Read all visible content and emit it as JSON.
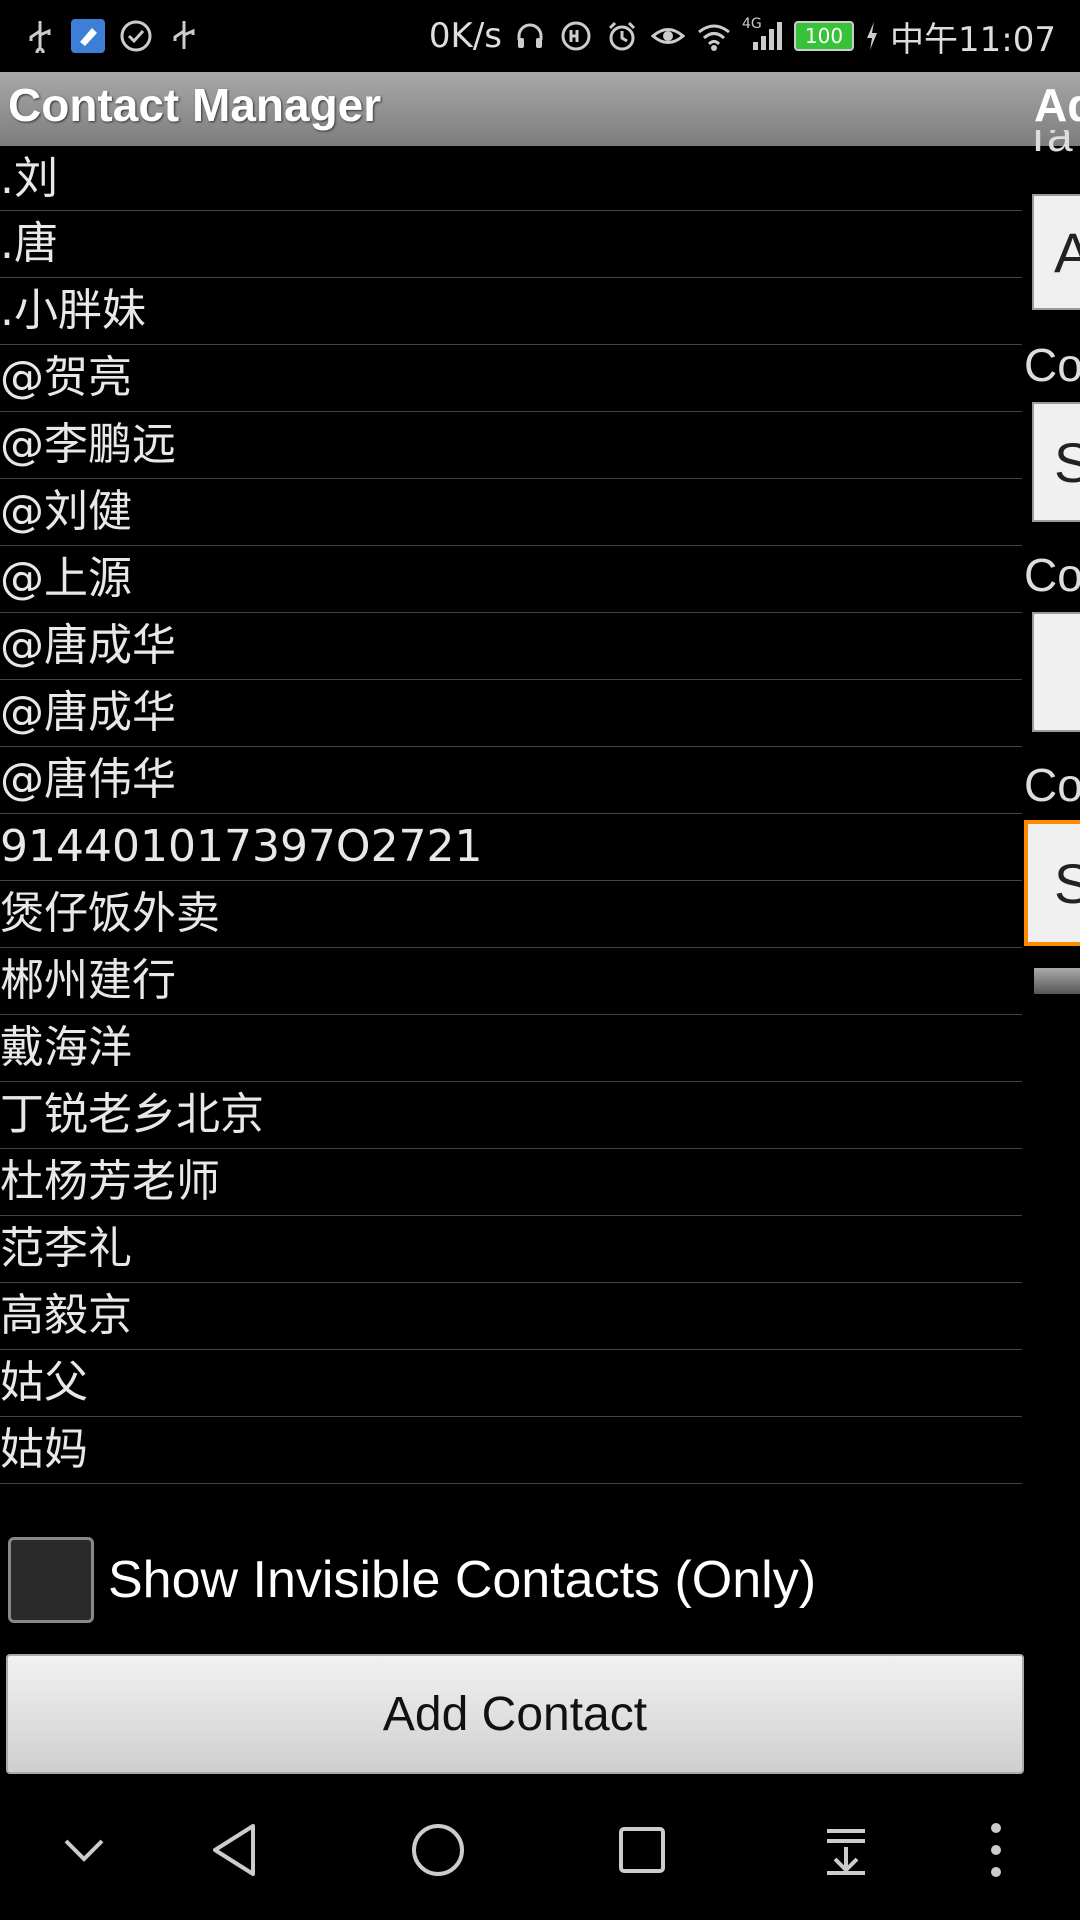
{
  "status_bar": {
    "net_speed": "0K/s",
    "network_type": "4G",
    "battery": "100",
    "time": "中午11:07",
    "icons_left": [
      "usb-icon",
      "app-icon",
      "check-circle-icon",
      "usb-icon"
    ],
    "icons_right": [
      "headset-icon",
      "hd-icon",
      "alarm-icon",
      "eye-icon",
      "wifi-icon",
      "signal-icon"
    ]
  },
  "title_bar": {
    "title": "Contact Manager",
    "right_title": "Ad"
  },
  "contacts": [
    ".刘",
    ".唐",
    ".小胖妹",
    "@贺亮",
    "@李鹏远",
    "@刘健",
    "@上源",
    "@唐成华",
    "@唐成华",
    "@唐伟华",
    "914401017397O2721",
    "煲仔饭外卖",
    "郴州建行",
    "戴海洋",
    "丁锐老乡北京",
    "杜杨芳老师",
    "范李礼",
    "高毅京",
    "姑父",
    "姑妈"
  ],
  "show_invisible": {
    "label": "Show Invisible Contacts (Only)",
    "checked": false
  },
  "add_contact": {
    "label": "Add Contact"
  },
  "right_panel": {
    "top_label": "Ta",
    "box1": "A",
    "label2": "Co",
    "box2": "S",
    "label3": "Co",
    "label4": "Co",
    "box4": "S"
  },
  "colors": {
    "title_bar": "#8f8f8f",
    "focus_border": "#ff8a00",
    "battery_green": "#38c23a"
  }
}
